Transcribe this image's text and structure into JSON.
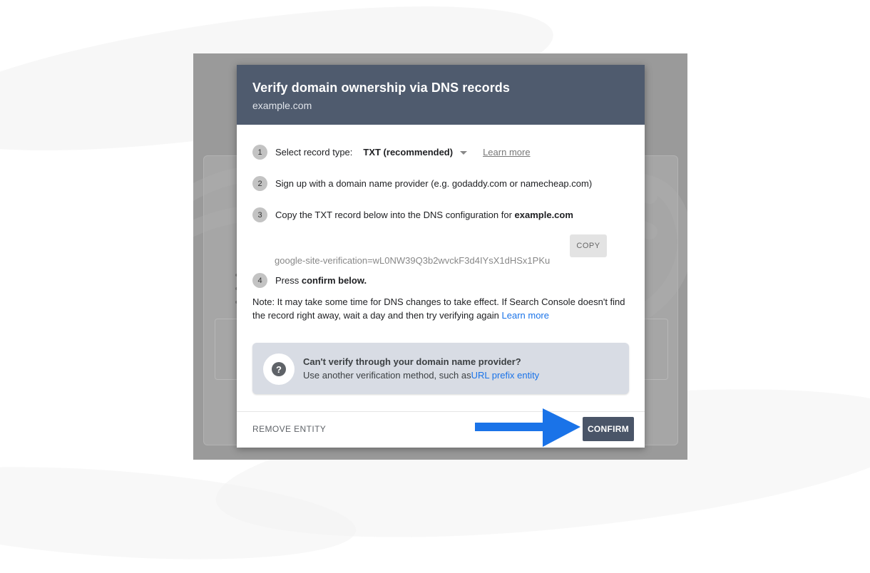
{
  "dialog": {
    "title": "Verify domain ownership via DNS records",
    "subtitle": "example.com"
  },
  "steps": [
    {
      "number": "1",
      "text": "Select record type:",
      "select_value": "TXT (recommended)",
      "link": "Learn more"
    },
    {
      "number": "2",
      "text": "Sign up with a domain name provider (e.g. godaddy.com or namecheap.com)"
    },
    {
      "number": "3",
      "text": "Copy the TXT record below into the DNS configuration for ",
      "bold": "example.com"
    },
    {
      "number": "4",
      "text": "Press ",
      "bold": "confirm below."
    }
  ],
  "record": {
    "value": "google-site-verification=wL0NW39Q3b2wvckF3d4IYsX1dHSx1PKu",
    "copy_label": "COPY"
  },
  "note": {
    "text": "Note: It may take some time for DNS changes to take effect. If Search Console doesn't find the record right away, wait a day and then try verifying again ",
    "link": "Learn more"
  },
  "help": {
    "title": "Can't verify through your domain name provider?",
    "text": "Use another verification method, such as",
    "link": "URL prefix entity"
  },
  "footer": {
    "remove_label": "REMOVE ENTITY",
    "confirm_label": "CONFIRM"
  },
  "colors": {
    "header": "#4f5b6e",
    "confirm": "#4a5568",
    "arrow": "#1a73e8",
    "link": "#1a73e8"
  }
}
